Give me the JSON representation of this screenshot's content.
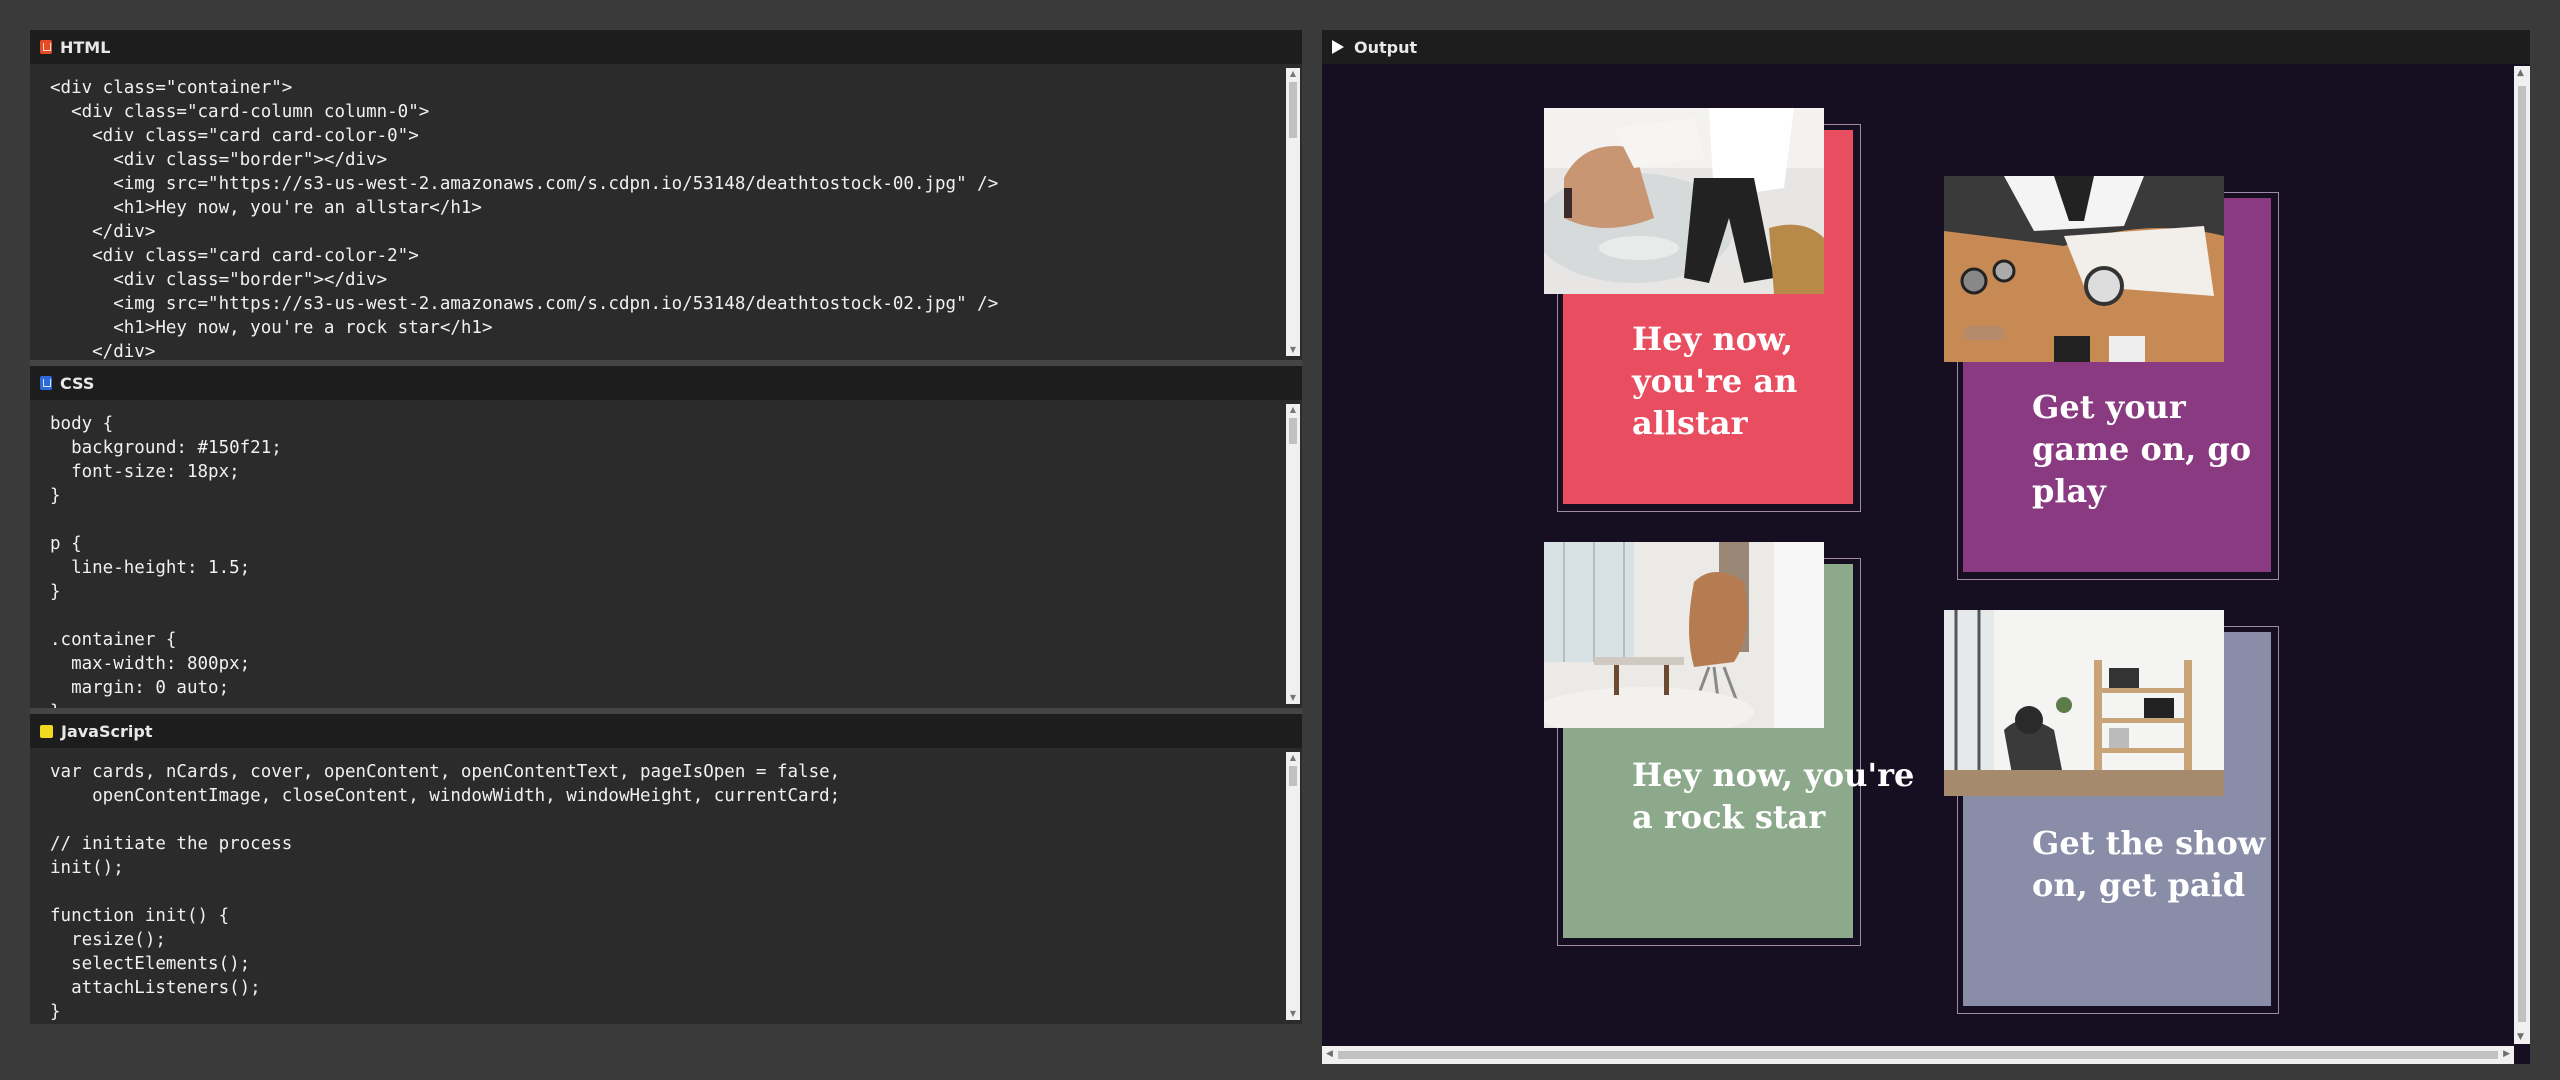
{
  "panels": {
    "html": {
      "title": "HTML",
      "lines": [
        "<div class=\"container\">",
        "  <div class=\"card-column column-0\">",
        "    <div class=\"card card-color-0\">",
        "      <div class=\"border\"></div>",
        "      <img src=\"https://s3-us-west-2.amazonaws.com/s.cdpn.io/53148/deathtostock-00.jpg\" />",
        "      <h1>Hey now, you're an allstar</h1>",
        "    </div>",
        "    <div class=\"card card-color-2\">",
        "      <div class=\"border\"></div>",
        "      <img src=\"https://s3-us-west-2.amazonaws.com/s.cdpn.io/53148/deathtostock-02.jpg\" />",
        "      <h1>Hey now, you're a rock star</h1>",
        "    </div>"
      ]
    },
    "css": {
      "title": "CSS",
      "lines": [
        "body {",
        "  background: #150f21;",
        "  font-size: 18px;",
        "}",
        "",
        "p {",
        "  line-height: 1.5;",
        "}",
        "",
        ".container {",
        "  max-width: 800px;",
        "  margin: 0 auto;",
        "}"
      ]
    },
    "js": {
      "title": "JavaScript",
      "lines": [
        "var cards, nCards, cover, openContent, openContentText, pageIsOpen = false,",
        "    openContentImage, closeContent, windowWidth, windowHeight, currentCard;",
        "",
        "// initiate the process",
        "init();",
        "",
        "function init() {",
        "  resize();",
        "  selectElements();",
        "  attachListeners();",
        "}"
      ]
    }
  },
  "output": {
    "title": "Output",
    "background": "#150f21",
    "cards": [
      {
        "heading": "Hey now, you're an allstar",
        "color": "#e84d60",
        "photo": "lounge-chairs-photo"
      },
      {
        "heading": "Get your game on, go play",
        "color": "#8a3a80",
        "photo": "wristwatch-desk-photo"
      },
      {
        "heading": "Hey now, you're a rock star",
        "color": "#8da98c",
        "photo": "egg-chair-living-room-photo"
      },
      {
        "heading": "Get the show on, get paid",
        "color": "#8a8da8",
        "photo": "bookshelf-room-photo"
      }
    ]
  }
}
